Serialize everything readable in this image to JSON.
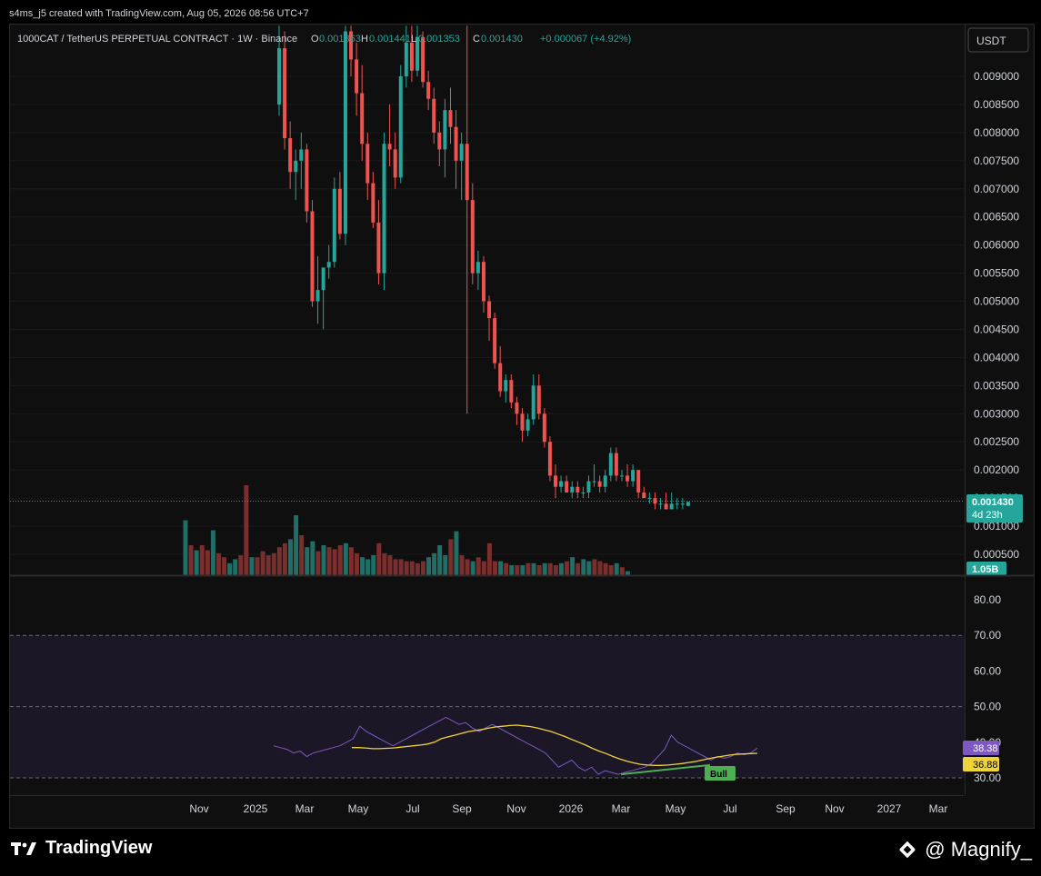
{
  "header": {
    "created_by": "s4ms_j5 created with TradingView.com, Aug 05, 2026 08:56 UTC+7"
  },
  "legend": {
    "symbol": "1000CAT / TetherUS PERPETUAL CONTRACT · 1W · Binance",
    "o_label": "O",
    "o_value": "0.001363",
    "h_label": "H",
    "h_value": "0.001441",
    "l_label": "L",
    "l_value": "0.001353",
    "c_label": "C",
    "c_value": "0.001430",
    "change": "+0.000067 (+4.92%)"
  },
  "currency_button": "USDT",
  "price_tag": {
    "value": "0.001430",
    "countdown": "4d 23h"
  },
  "volume_tag": "1.05B",
  "rsi_tags": {
    "rsi": "38.38",
    "ma": "36.88"
  },
  "bull_label": "Bull",
  "colors": {
    "up": "#26a69a",
    "down": "#ef5350",
    "vol_up": "#1f6f66",
    "vol_down": "#7a2e2d",
    "rsi": "#7e57c2",
    "rsi_ma": "#f0d33a",
    "bull": "#4caf50",
    "rsi_band": "#1b1726"
  },
  "footer": {
    "brand": "TradingView",
    "watermark": "@ Magnify_"
  },
  "chart_data": [
    {
      "type": "candlestick",
      "title": "",
      "y_axis": {
        "ticks": [
          "0.009000",
          "0.008500",
          "0.008000",
          "0.007500",
          "0.007000",
          "0.006500",
          "0.006000",
          "0.005500",
          "0.005000",
          "0.004500",
          "0.004000",
          "0.003500",
          "0.003000",
          "0.002500",
          "0.002000",
          "0.001500",
          "0.001000",
          "0.000500"
        ],
        "range": [
          0.0,
          0.0097
        ]
      },
      "x_axis": {
        "ticks": [
          "Nov",
          "2025",
          "Mar",
          "May",
          "Jul",
          "Sep",
          "Nov",
          "2026",
          "Mar",
          "May",
          "Jul",
          "Sep",
          "Nov",
          "2027",
          "Mar"
        ]
      },
      "last_close": 0.00143,
      "candles": [
        [
          0.0085,
          0.0099,
          0.0083,
          0.0095
        ],
        [
          0.0095,
          0.0098,
          0.0077,
          0.0079
        ],
        [
          0.0079,
          0.0082,
          0.007,
          0.0073
        ],
        [
          0.0073,
          0.0077,
          0.0068,
          0.0075
        ],
        [
          0.0075,
          0.008,
          0.007,
          0.0077
        ],
        [
          0.0077,
          0.0078,
          0.0064,
          0.0066
        ],
        [
          0.0066,
          0.0068,
          0.0049,
          0.005
        ],
        [
          0.005,
          0.0058,
          0.0046,
          0.0052
        ],
        [
          0.0052,
          0.0056,
          0.0045,
          0.0056
        ],
        [
          0.0056,
          0.006,
          0.0054,
          0.0057
        ],
        [
          0.0057,
          0.0072,
          0.0056,
          0.007
        ],
        [
          0.007,
          0.0073,
          0.0061,
          0.0062
        ],
        [
          0.0062,
          0.0099,
          0.006,
          0.0098
        ],
        [
          0.0098,
          0.0099,
          0.009,
          0.0093
        ],
        [
          0.0093,
          0.0096,
          0.0083,
          0.0087
        ],
        [
          0.0087,
          0.0092,
          0.0075,
          0.0078
        ],
        [
          0.0078,
          0.008,
          0.0068,
          0.0071
        ],
        [
          0.0071,
          0.0073,
          0.0063,
          0.0064
        ],
        [
          0.0064,
          0.0068,
          0.0053,
          0.0055
        ],
        [
          0.0055,
          0.008,
          0.0052,
          0.0078
        ],
        [
          0.0078,
          0.0085,
          0.0074,
          0.0077
        ],
        [
          0.0077,
          0.008,
          0.007,
          0.0072
        ],
        [
          0.0072,
          0.0092,
          0.0071,
          0.009
        ],
        [
          0.009,
          0.0099,
          0.0088,
          0.0096
        ],
        [
          0.0096,
          0.0099,
          0.0089,
          0.0091
        ],
        [
          0.0091,
          0.0099,
          0.009,
          0.0097
        ],
        [
          0.0097,
          0.0098,
          0.0088,
          0.0089
        ],
        [
          0.0089,
          0.0091,
          0.0084,
          0.0086
        ],
        [
          0.0086,
          0.0088,
          0.0078,
          0.008
        ],
        [
          0.008,
          0.0082,
          0.0074,
          0.0077
        ],
        [
          0.0077,
          0.0086,
          0.0072,
          0.0084
        ],
        [
          0.0084,
          0.0088,
          0.0078,
          0.0081
        ],
        [
          0.0081,
          0.0084,
          0.007,
          0.0075
        ],
        [
          0.0075,
          0.008,
          0.0068,
          0.0078
        ],
        [
          0.0078,
          0.0099,
          0.003,
          0.0068
        ],
        [
          0.0068,
          0.0071,
          0.0053,
          0.0055
        ],
        [
          0.0055,
          0.0059,
          0.0052,
          0.0057
        ],
        [
          0.0057,
          0.0058,
          0.0048,
          0.005
        ],
        [
          0.005,
          0.0051,
          0.0043,
          0.0047
        ],
        [
          0.0047,
          0.0048,
          0.0038,
          0.0039
        ],
        [
          0.0039,
          0.0042,
          0.0033,
          0.0034
        ],
        [
          0.0034,
          0.0037,
          0.0032,
          0.0036
        ],
        [
          0.0036,
          0.0037,
          0.0031,
          0.0032
        ],
        [
          0.0032,
          0.0033,
          0.0028,
          0.003
        ],
        [
          0.003,
          0.0031,
          0.0025,
          0.0027
        ],
        [
          0.0027,
          0.003,
          0.0026,
          0.0029
        ],
        [
          0.0029,
          0.0037,
          0.0028,
          0.0035
        ],
        [
          0.0035,
          0.0037,
          0.0029,
          0.003
        ],
        [
          0.003,
          0.0031,
          0.0024,
          0.0025
        ],
        [
          0.0025,
          0.0026,
          0.0018,
          0.0019
        ],
        [
          0.0019,
          0.0021,
          0.0015,
          0.0017
        ],
        [
          0.0017,
          0.0019,
          0.0016,
          0.0018
        ],
        [
          0.0018,
          0.0019,
          0.0016,
          0.0016
        ],
        [
          0.0016,
          0.0018,
          0.0015,
          0.0017
        ],
        [
          0.0017,
          0.0018,
          0.0015,
          0.0016
        ],
        [
          0.0016,
          0.0017,
          0.0015,
          0.0016
        ],
        [
          0.0016,
          0.0019,
          0.0015,
          0.0018
        ],
        [
          0.0018,
          0.0021,
          0.0017,
          0.0018
        ],
        [
          0.0018,
          0.0019,
          0.0016,
          0.0017
        ],
        [
          0.0017,
          0.002,
          0.0016,
          0.0019
        ],
        [
          0.0019,
          0.0024,
          0.0018,
          0.0023
        ],
        [
          0.0023,
          0.0024,
          0.0018,
          0.0019
        ],
        [
          0.0019,
          0.002,
          0.0018,
          0.0019
        ],
        [
          0.0019,
          0.0021,
          0.0017,
          0.0018
        ],
        [
          0.0018,
          0.0021,
          0.0017,
          0.002
        ],
        [
          0.002,
          0.002,
          0.0015,
          0.0016
        ],
        [
          0.0016,
          0.0017,
          0.0015,
          0.0015
        ],
        [
          0.0015,
          0.0016,
          0.0014,
          0.0015
        ],
        [
          0.0015,
          0.0016,
          0.0013,
          0.0014
        ],
        [
          0.0014,
          0.0015,
          0.0013,
          0.0014
        ],
        [
          0.0014,
          0.0016,
          0.0013,
          0.0013
        ],
        [
          0.0013,
          0.0016,
          0.0013,
          0.0014
        ],
        [
          0.0014,
          0.0015,
          0.0013,
          0.0014
        ],
        [
          0.0014,
          0.0015,
          0.0013,
          0.0014
        ],
        [
          0.001363,
          0.001441,
          0.001353,
          0.00143
        ]
      ]
    },
    {
      "type": "bar",
      "title": "Volume",
      "last_value": "1.05B",
      "values": [
        0.55,
        0.3,
        0.25,
        0.3,
        0.25,
        0.45,
        0.22,
        0.18,
        0.12,
        0.16,
        0.2,
        0.9,
        0.18,
        0.18,
        0.24,
        0.2,
        0.22,
        0.28,
        0.32,
        0.36,
        0.6,
        0.4,
        0.28,
        0.34,
        0.24,
        0.3,
        0.28,
        0.26,
        0.3,
        0.32,
        0.28,
        0.22,
        0.18,
        0.16,
        0.2,
        0.32,
        0.22,
        0.2,
        0.16,
        0.16,
        0.14,
        0.14,
        0.12,
        0.14,
        0.18,
        0.22,
        0.3,
        0.2,
        0.36,
        0.44,
        0.2,
        0.16,
        0.14,
        0.18,
        0.14,
        0.32,
        0.14,
        0.14,
        0.12,
        0.1,
        0.1,
        0.1,
        0.12,
        0.12,
        0.1,
        0.12,
        0.12,
        0.1,
        0.12,
        0.14,
        0.18,
        0.12,
        0.16,
        0.14,
        0.16,
        0.14,
        0.12,
        0.1,
        0.12,
        0.08,
        0.04
      ],
      "up": [
        true,
        false,
        true,
        false,
        false,
        true,
        false,
        false,
        true,
        true,
        false,
        false,
        true,
        false,
        false,
        false,
        false,
        false,
        false,
        true,
        true,
        false,
        true,
        true,
        false,
        true,
        false,
        false,
        false,
        true,
        false,
        false,
        true,
        true,
        true,
        false,
        false,
        false,
        false,
        false,
        false,
        false,
        false,
        false,
        true,
        true,
        true,
        true,
        false,
        true,
        false,
        false,
        true,
        false,
        false,
        false,
        false,
        true,
        false,
        true,
        false,
        true,
        false,
        true,
        false,
        true,
        false,
        false,
        true,
        false,
        true,
        false,
        true,
        true,
        false,
        false,
        false,
        false,
        true,
        false,
        true
      ]
    },
    {
      "type": "line",
      "title": "RSI",
      "y_axis": {
        "ticks": [
          "80.00",
          "70.00",
          "60.00",
          "50.00",
          "40.00",
          "30.00"
        ],
        "range": [
          27,
          85
        ]
      },
      "bands": [
        30,
        50,
        70
      ],
      "series": [
        {
          "values": [
            39,
            38.5,
            38,
            37,
            37.5,
            36,
            37,
            37.5,
            38,
            38.5,
            39,
            40,
            41,
            44.5,
            43,
            42,
            41,
            40,
            39,
            40,
            41,
            42,
            43,
            44,
            45,
            46,
            47,
            46,
            45,
            45.5,
            44,
            43,
            44,
            45,
            44,
            43,
            42,
            41,
            40,
            39,
            38,
            37,
            35,
            33,
            34,
            35,
            33,
            32,
            33,
            31,
            32,
            31.5,
            31,
            31.5,
            32,
            32.5,
            33,
            34,
            36,
            38,
            42,
            40,
            39,
            38,
            37,
            36,
            35,
            36,
            35.5,
            36,
            37,
            36.5,
            37,
            38.38
          ]
        },
        {
          "values": [
            38.5,
            38.5,
            38.4,
            38.2,
            38.2,
            38.3,
            38.4,
            38.6,
            38.8,
            39,
            39.2,
            39.5,
            40,
            41,
            41.5,
            42,
            42.5,
            43,
            43.3,
            43.6,
            44,
            44.3,
            44.5,
            44.7,
            44.8,
            44.6,
            44.4,
            44,
            43.5,
            43,
            42.3,
            41.6,
            40.8,
            40,
            39.2,
            38.3,
            37.5,
            36.8,
            36,
            35.3,
            34.7,
            34.2,
            33.8,
            33.6,
            33.5,
            33.5,
            33.6,
            33.8,
            34,
            34.3,
            34.6,
            35,
            35.4,
            35.8,
            36.1,
            36.4,
            36.6,
            36.7,
            36.8,
            36.88
          ]
        }
      ]
    }
  ]
}
